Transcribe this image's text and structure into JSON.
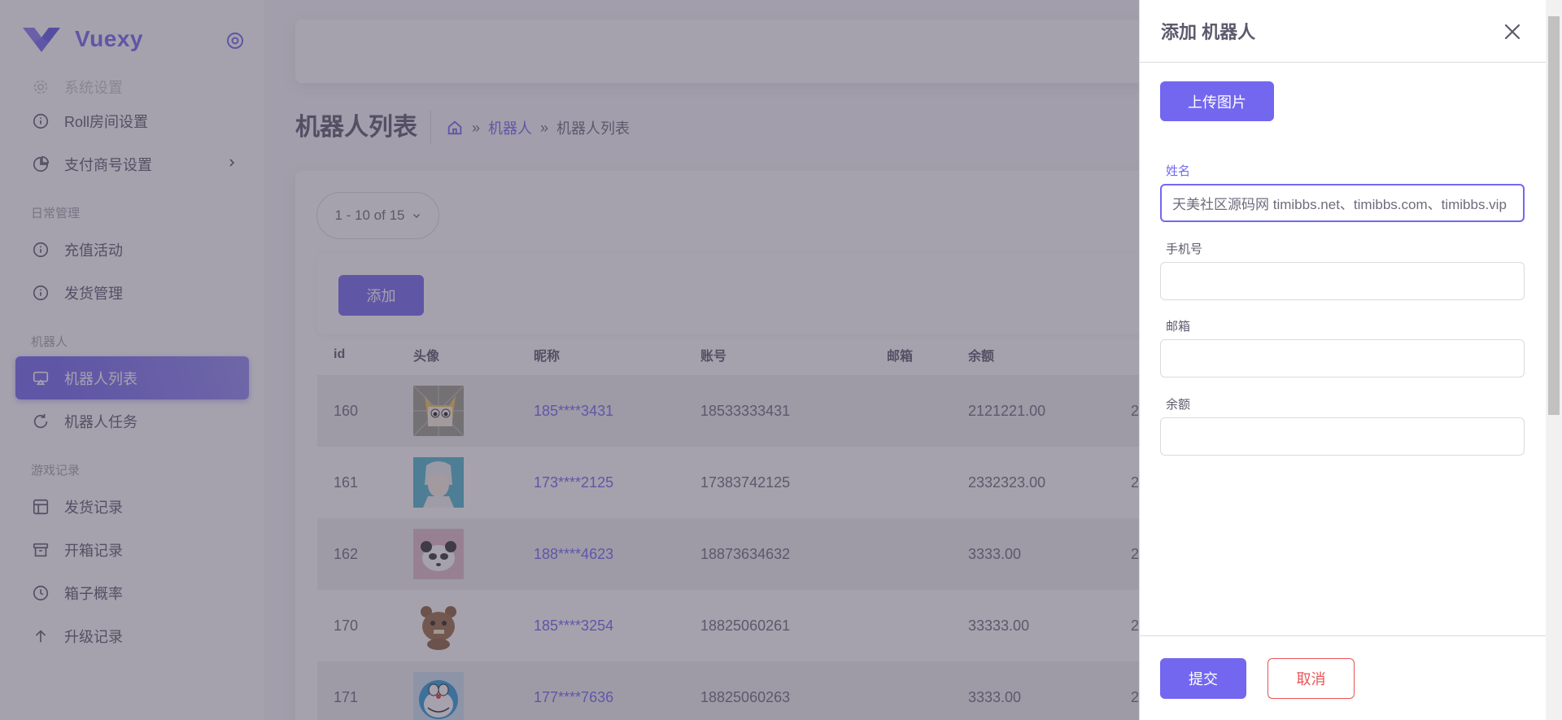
{
  "brand": {
    "name": "Vuexy",
    "logo_icon": "vuexy-logo-icon",
    "accent": "#7367f0"
  },
  "sidebar": {
    "items": [
      {
        "label": "系统设置",
        "icon": "gear-icon"
      },
      {
        "label": "Roll房间设置",
        "icon": "info-circle-icon"
      },
      {
        "label": "支付商号设置",
        "icon": "pie-chart-icon"
      }
    ],
    "headers": {
      "daily": "日常管理",
      "robot": "机器人",
      "game": "游戏记录"
    },
    "daily_items": [
      {
        "label": "充值活动",
        "icon": "info-circle-icon"
      },
      {
        "label": "发货管理",
        "icon": "info-circle-icon"
      }
    ],
    "robot_items": [
      {
        "label": "机器人列表",
        "icon": "screen-share-icon",
        "active": true
      },
      {
        "label": "机器人任务",
        "icon": "refresh-icon"
      }
    ],
    "game_items": [
      {
        "label": "发货记录",
        "icon": "layout-icon"
      },
      {
        "label": "开箱记录",
        "icon": "archive-icon"
      },
      {
        "label": "箱子概率",
        "icon": "clock-icon"
      },
      {
        "label": "升级记录",
        "icon": "arrow-up-icon"
      }
    ]
  },
  "page": {
    "title": "机器人列表",
    "breadcrumb": {
      "sep": "»",
      "link": "机器人",
      "current": "机器人列表"
    }
  },
  "pager": {
    "label": "1 - 10 of 15"
  },
  "toolbar": {
    "add_label": "添加"
  },
  "table": {
    "columns": [
      "id",
      "头像",
      "昵称",
      "账号",
      "邮箱",
      "余额"
    ],
    "rows": [
      {
        "id": "160",
        "avatar": "cartoon-cat-avatar",
        "nick": "185****3431",
        "account": "18533333431",
        "email": "",
        "balance": "2121221.00",
        "extra": "2"
      },
      {
        "id": "161",
        "avatar": "anime-boy-avatar",
        "nick": "173****2125",
        "account": "17383742125",
        "email": "",
        "balance": "2332323.00",
        "extra": "2"
      },
      {
        "id": "162",
        "avatar": "panda-avatar",
        "nick": "188****4623",
        "account": "18873634632",
        "email": "",
        "balance": "3333.00",
        "extra": "2"
      },
      {
        "id": "170",
        "avatar": "brown-critter-avatar",
        "nick": "185****3254",
        "account": "18825060261",
        "email": "",
        "balance": "33333.00",
        "extra": "2"
      },
      {
        "id": "171",
        "avatar": "doraemon-avatar",
        "nick": "177****7636",
        "account": "18825060263",
        "email": "",
        "balance": "3333.00",
        "extra": "2"
      }
    ]
  },
  "drawer": {
    "title": "添加 机器人",
    "upload_label": "上传图片",
    "fields": {
      "name": {
        "label": "姓名",
        "value": "天美社区源码网 timibbs.net、timibbs.com、timibbs.vip"
      },
      "phone": {
        "label": "手机号",
        "value": ""
      },
      "email": {
        "label": "邮箱",
        "value": ""
      },
      "balance": {
        "label": "余额",
        "value": ""
      }
    },
    "submit_label": "提交",
    "cancel_label": "取消"
  }
}
